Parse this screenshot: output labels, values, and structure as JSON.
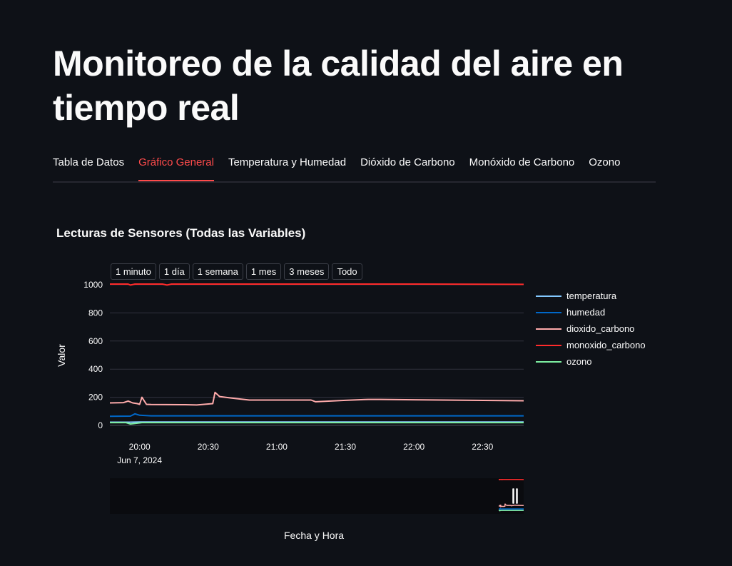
{
  "title": "Monitoreo de la calidad del aire en tiempo real",
  "tabs": [
    {
      "label": "Tabla de Datos",
      "active": false
    },
    {
      "label": "Gráfico General",
      "active": true
    },
    {
      "label": "Temperatura y Humedad",
      "active": false
    },
    {
      "label": "Dióxido de Carbono",
      "active": false
    },
    {
      "label": "Monóxido de Carbono",
      "active": false
    },
    {
      "label": "Ozono",
      "active": false
    }
  ],
  "chart": {
    "title": "Lecturas de Sensores (Todas las Variables)",
    "range_buttons": [
      "1 minuto",
      "1 día",
      "1 semana",
      "1 mes",
      "3 meses",
      "Todo"
    ]
  },
  "colors": {
    "background": "#0e1117",
    "accent": "#ff4b4b",
    "grid": "#31333f"
  },
  "chart_data": {
    "type": "line",
    "title": "Lecturas de Sensores (Todas las Variables)",
    "xlabel": "Fecha y Hora",
    "ylabel": "Valor",
    "date_label": "Jun 7, 2024",
    "x_ticks": [
      "20:00",
      "20:30",
      "21:00",
      "21:30",
      "22:00",
      "22:30"
    ],
    "xlim": [
      "19:47",
      "22:48"
    ],
    "ylim": [
      0,
      1000
    ],
    "y_ticks": [
      0,
      200,
      400,
      600,
      800,
      1000
    ],
    "legend_position": "right",
    "grid": true,
    "series": [
      {
        "name": "temperatura",
        "color": "#83c9ff",
        "x": [
          "19:47",
          "19:56",
          "20:00",
          "22:48"
        ],
        "y": [
          23,
          23,
          24,
          24
        ]
      },
      {
        "name": "humedad",
        "color": "#0068c9",
        "x": [
          "19:47",
          "19:56",
          "19:58",
          "20:00",
          "20:05",
          "20:30",
          "21:00",
          "22:48"
        ],
        "y": [
          65,
          66,
          82,
          72,
          68,
          68,
          68,
          68
        ]
      },
      {
        "name": "dioxido_carbono",
        "color": "#ffabab",
        "x": [
          "19:47",
          "19:53",
          "19:55",
          "19:57",
          "19:59",
          "20:00",
          "20:01",
          "20:03",
          "20:05",
          "20:20",
          "20:25",
          "20:32",
          "20:33",
          "20:35",
          "20:40",
          "20:48",
          "21:00",
          "21:15",
          "21:17",
          "21:30",
          "21:40",
          "21:45",
          "22:00",
          "22:48"
        ],
        "y": [
          160,
          162,
          173,
          160,
          155,
          150,
          200,
          150,
          148,
          147,
          145,
          155,
          235,
          205,
          195,
          180,
          180,
          180,
          168,
          178,
          185,
          185,
          182,
          175
        ]
      },
      {
        "name": "monoxido_carbono",
        "color": "#ff2b2b",
        "x": [
          "19:47",
          "19:55",
          "19:56",
          "19:58",
          "20:10",
          "20:12",
          "20:14",
          "20:30",
          "21:00",
          "21:30",
          "22:00",
          "22:48"
        ],
        "y": [
          1005,
          1005,
          998,
          1005,
          1005,
          998,
          1005,
          1005,
          1005,
          1005,
          1005,
          1003
        ]
      },
      {
        "name": "ozono",
        "color": "#7defa1",
        "x": [
          "19:47",
          "19:54",
          "19:56",
          "19:58",
          "20:01",
          "20:05",
          "22:48"
        ],
        "y": [
          20,
          20,
          10,
          14,
          20,
          20,
          20
        ]
      }
    ]
  }
}
